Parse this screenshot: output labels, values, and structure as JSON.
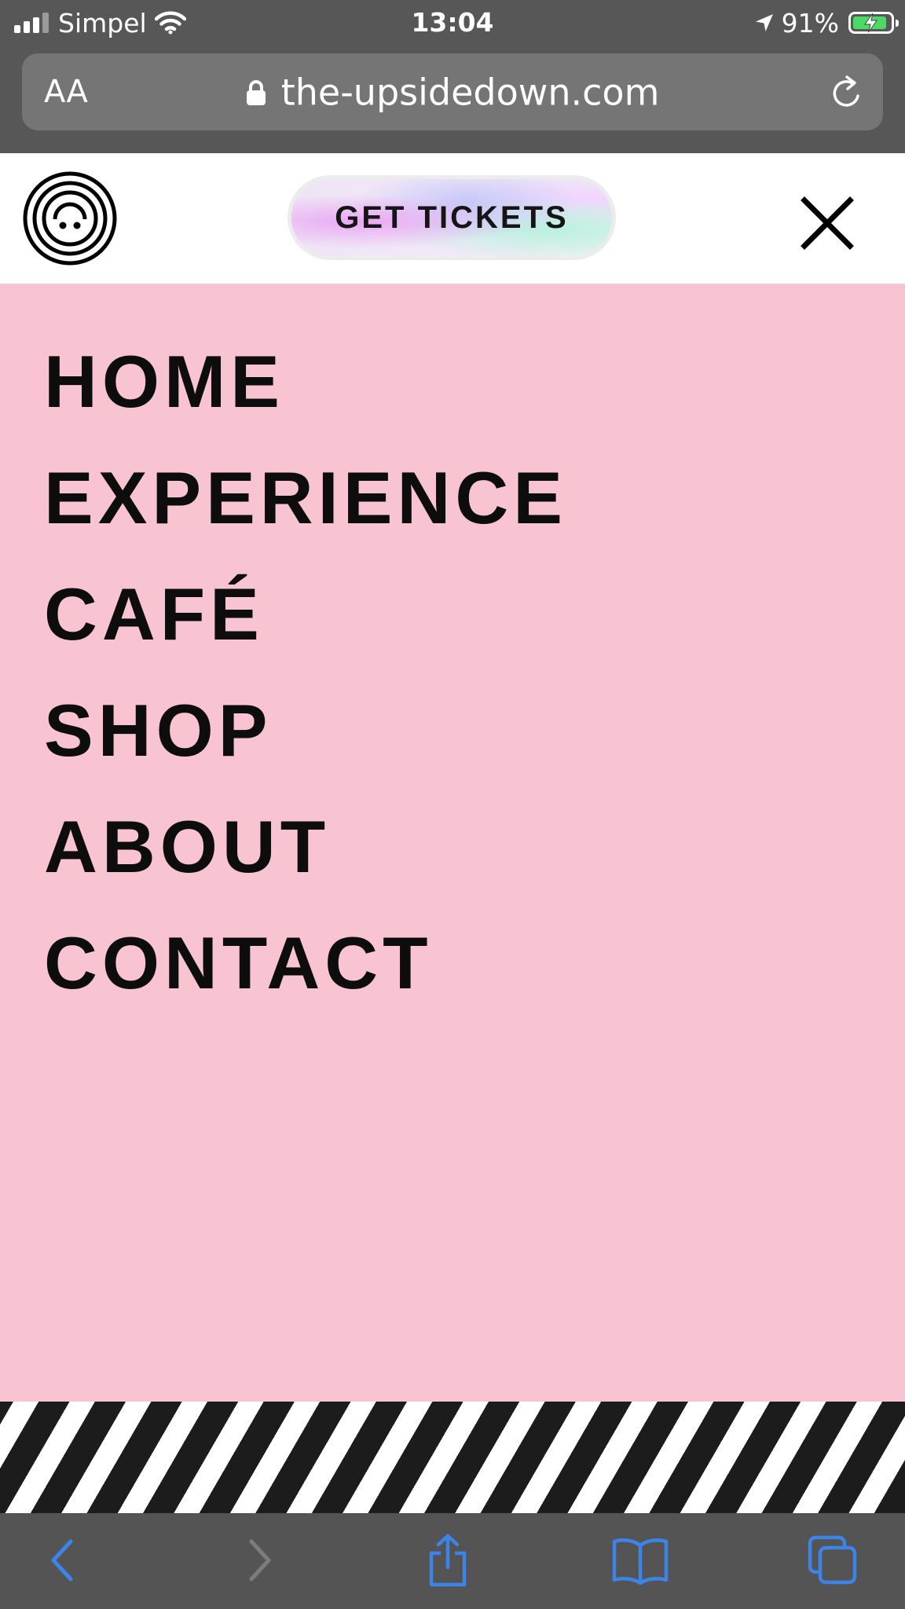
{
  "status_bar": {
    "carrier": "Simpel",
    "time": "13:04",
    "battery_percent": "91%",
    "battery_level": 0.91,
    "charging": true,
    "icons": [
      "signal-bars-icon",
      "wifi-icon",
      "location-arrow-icon",
      "battery-icon"
    ]
  },
  "browser": {
    "text_size_label": "AA",
    "url": "the-upsidedown.com",
    "icons": [
      "lock-icon",
      "reload-icon"
    ]
  },
  "header": {
    "logo": "spiral-smiley-logo",
    "cta_label": "GET TICKETS",
    "close_icon": "close-icon"
  },
  "menu": {
    "items": [
      {
        "label": "HOME"
      },
      {
        "label": "EXPERIENCE"
      },
      {
        "label": "CAFÉ"
      },
      {
        "label": "SHOP"
      },
      {
        "label": "ABOUT"
      },
      {
        "label": "CONTACT"
      }
    ]
  },
  "toolbar": {
    "icons": [
      "back-icon",
      "forward-icon",
      "share-icon",
      "bookmarks-icon",
      "tabs-icon"
    ]
  },
  "colors": {
    "menu_background": "#f9c4d2",
    "browser_chrome": "#575757",
    "toolbar_icon_blue": "#3d84e8",
    "battery_green": "#4cd964"
  }
}
